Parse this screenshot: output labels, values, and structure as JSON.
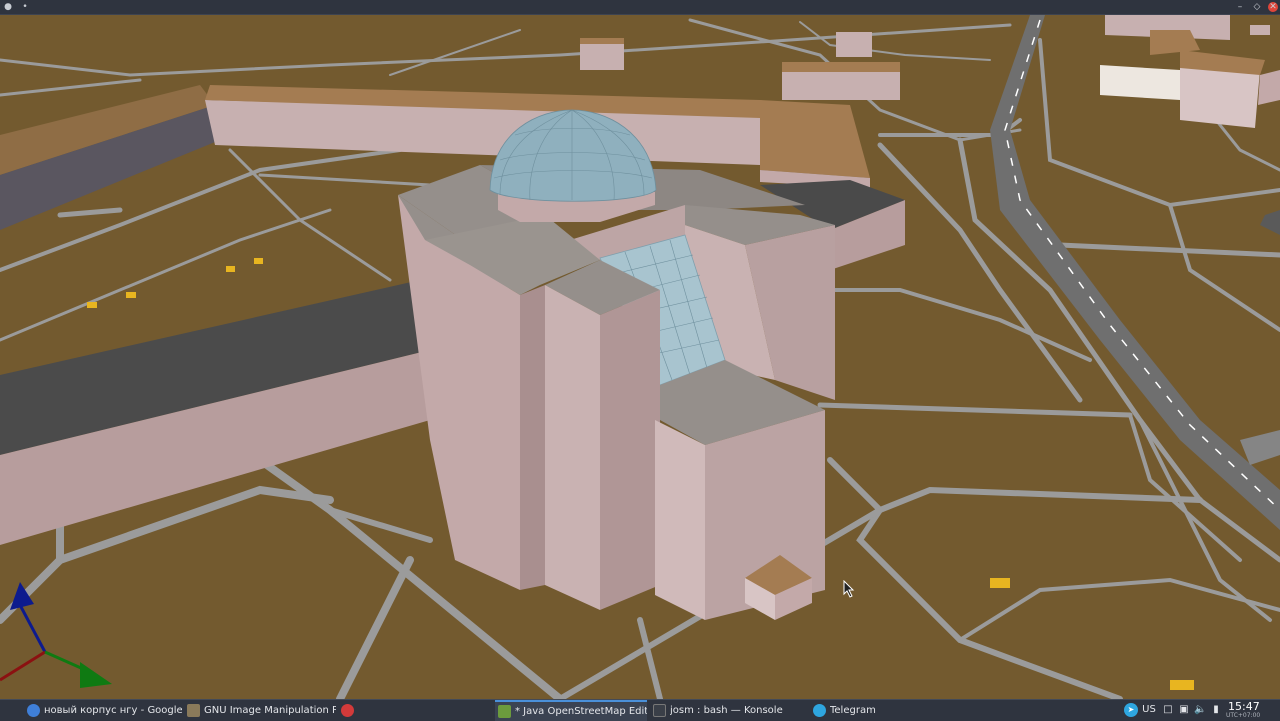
{
  "window": {
    "app_icon": "josm-icon",
    "pin_icon": "pin-icon",
    "controls": {
      "minimize": "–",
      "maximize": "◇",
      "close": "✕"
    }
  },
  "scene": {
    "colors": {
      "ground": "#735a2f",
      "road": "#9b9b9b",
      "road_dark": "#747474",
      "building_wall": "#c3a9a9",
      "building_wall_shade": "#a98f8f",
      "roof": "#958f8b",
      "roof_dark": "#4a4a4a",
      "dome": "#8fb0be",
      "glass": "#a8c4cf",
      "brown_roof": "#a47c52",
      "bench": "#e8b520"
    },
    "axes_gizmo": {
      "x_color": "#8b1111",
      "y_color": "#0f7a12",
      "z_color": "#0d1b8e"
    }
  },
  "taskbar": {
    "tasks": [
      {
        "label": "новый корпус нгу - Google ...",
        "icon": "chrome-icon",
        "icon_color": "#3f7fd8",
        "active": false
      },
      {
        "label": "GNU Image Manipulation Pr...",
        "icon": "gimp-icon",
        "icon_color": "#8a7a5a",
        "active": false
      },
      {
        "label": "",
        "icon": "app-red-icon",
        "icon_color": "#d33a3a",
        "active": false
      },
      {
        "label": "* Java OpenStreetMap Editor",
        "icon": "josm-icon",
        "icon_color": "#6c9b3d",
        "active": true
      },
      {
        "label": "josm : bash — Konsole",
        "icon": "terminal-icon",
        "icon_color": "#3a3f48",
        "active": false
      },
      {
        "label": "Telegram",
        "icon": "telegram-icon",
        "icon_color": "#2ea6e0",
        "active": false
      }
    ],
    "tray": {
      "keyboard_layout": "US",
      "clock_time": "15:47",
      "clock_tz": "UTC+07:00"
    }
  }
}
